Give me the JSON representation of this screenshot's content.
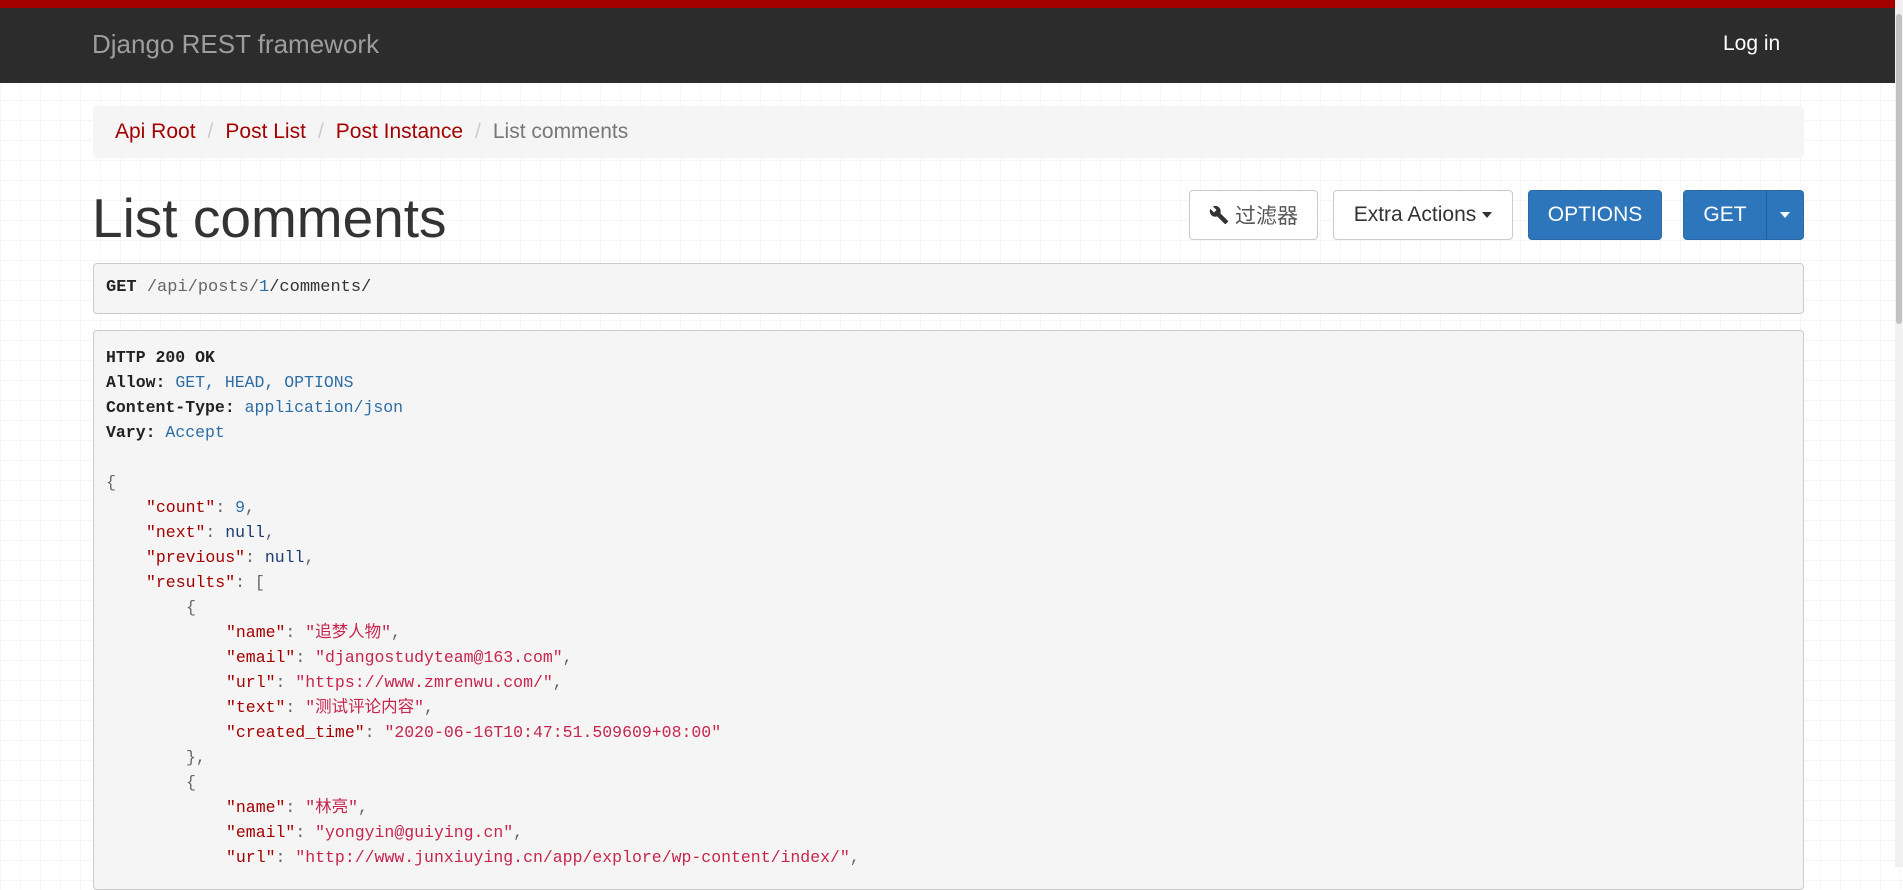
{
  "navbar": {
    "brand": "Django REST framework",
    "login": "Log in",
    "accent_color": "#a30000",
    "background_color": "#2c2c2c"
  },
  "breadcrumb": {
    "items": [
      "Api Root",
      "Post List",
      "Post Instance"
    ],
    "separator": "/",
    "active": "List comments"
  },
  "page": {
    "title": "List comments"
  },
  "toolbar": {
    "filter_label": "过滤器",
    "filter_icon": "wrench-icon",
    "extra_actions_label": "Extra Actions",
    "options_label": "OPTIONS",
    "get_label": "GET",
    "primary_color": "#2e76bb"
  },
  "request": {
    "method": "GET",
    "path_prefix": "/api/posts/",
    "path_id": "1",
    "path_suffix": "/comments/"
  },
  "response": {
    "status": "HTTP 200 OK",
    "headers": [
      {
        "name": "Allow:",
        "value": "GET, HEAD, OPTIONS"
      },
      {
        "name": "Content-Type:",
        "value": "application/json"
      },
      {
        "name": "Vary:",
        "value": "Accept"
      }
    ],
    "body": {
      "count_key": "\"count\"",
      "count": "9",
      "next_key": "\"next\"",
      "next": "null",
      "previous_key": "\"previous\"",
      "previous": "null",
      "results_key": "\"results\"",
      "results": [
        {
          "name": "\"追梦人物\"",
          "email": "\"djangostudyteam@163.com\"",
          "url": "\"https://www.zmrenwu.com/\"",
          "text": "\"测试评论内容\"",
          "created_time": "\"2020-06-16T10:47:51.509609+08:00\""
        },
        {
          "name": "\"林亮\"",
          "email": "\"yongyin@guiying.cn\"",
          "url": "\"http://www.junxiuying.cn/app/explore/wp-content/index/\""
        }
      ],
      "field_keys": {
        "name": "\"name\"",
        "email": "\"email\"",
        "url": "\"url\"",
        "text": "\"text\"",
        "created_time": "\"created_time\""
      }
    }
  }
}
